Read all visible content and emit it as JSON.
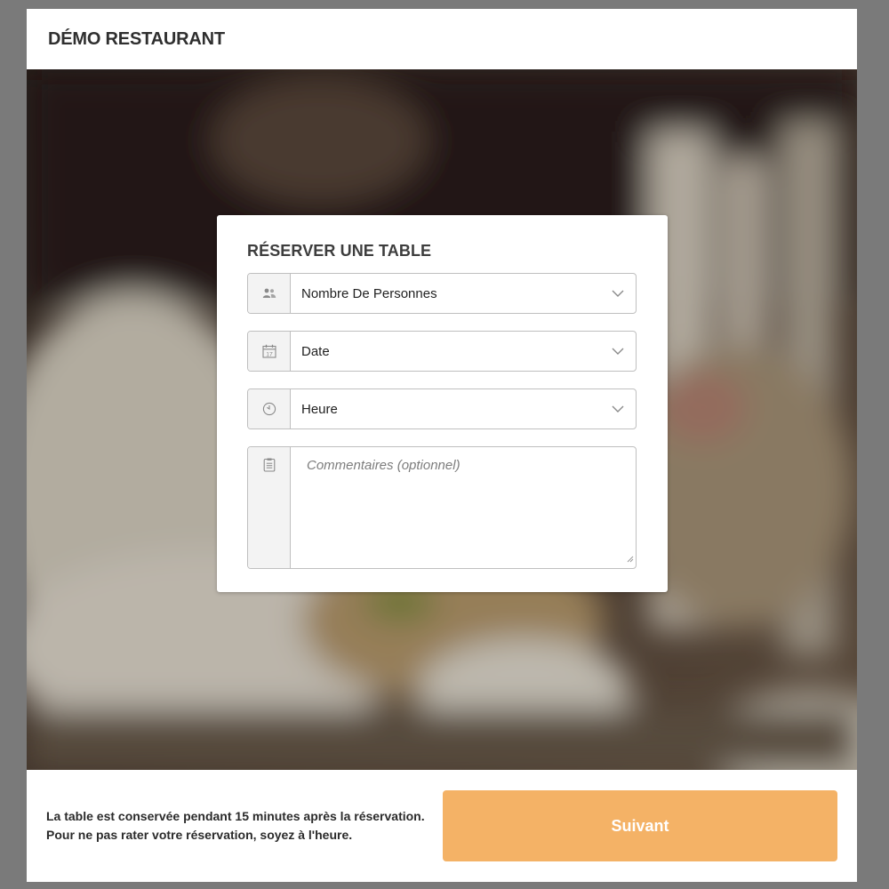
{
  "header": {
    "title": "DÉMO RESTAURANT"
  },
  "form": {
    "title": "RÉSERVER UNE TABLE",
    "fields": [
      {
        "icon": "people-icon",
        "value": "Nombre De Personnes"
      },
      {
        "icon": "calendar-icon",
        "value": "Date"
      },
      {
        "icon": "clock-icon",
        "value": "Heure"
      }
    ],
    "comments": {
      "icon": "notepad-icon",
      "placeholder": "Commentaires (optionnel)"
    }
  },
  "footer": {
    "notice_line1": "La table est conservée pendant 15 minutes après la réservation.",
    "notice_line2": "Pour ne pas rater votre réservation, soyez à l'heure.",
    "next_label": "Suivant"
  },
  "colors": {
    "accent": "#f4b266",
    "page_background": "#7a7a7a"
  }
}
